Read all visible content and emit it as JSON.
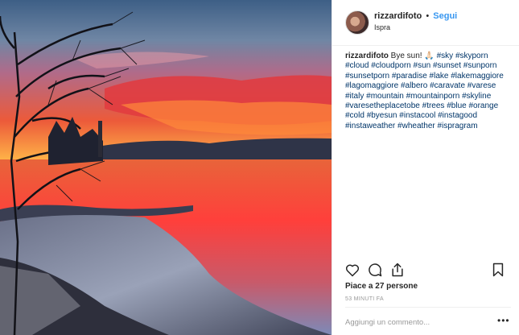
{
  "post": {
    "username": "rizzardifoto",
    "separator": "•",
    "follow_label": "Segui",
    "location": "Ispra"
  },
  "caption": {
    "username": "rizzardifoto",
    "text_before": " Bye sun! 🙏🏻",
    "hashtags": [
      "#sky",
      "#skyporn",
      "#cloud",
      "#cloudporn",
      "#sun",
      "#sunset",
      "#sunporn",
      "#sunsetporn",
      "#paradise",
      "#lake",
      "#lakemaggiore",
      "#lagomaggiore",
      "#albero",
      "#caravate",
      "#varese",
      "#italy",
      "#mountain",
      "#mountainporn",
      "#skyline",
      "#varesetheplacetobe",
      "#trees",
      "#blue",
      "#orange",
      "#cold",
      "#byesun",
      "#instacool",
      "#instagood",
      "#instaweather",
      "#wheather",
      "#ispragram"
    ]
  },
  "actions": {
    "icons": [
      "heart-icon",
      "comment-icon",
      "share-icon",
      "bookmark-icon"
    ]
  },
  "likes_text": "Piace a 27 persone",
  "timestamp": "53 MINUTI FA",
  "comment": {
    "placeholder": "Aggiungi un commento...",
    "more_label": "•••"
  },
  "colors": {
    "follow": "#3897f0",
    "hashtag": "#003569",
    "muted": "#999999",
    "text": "#262626"
  }
}
